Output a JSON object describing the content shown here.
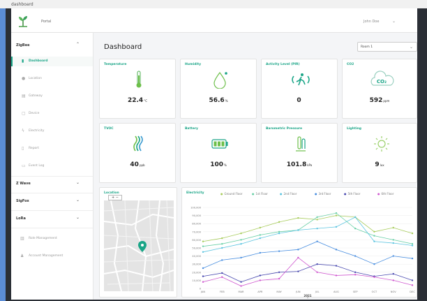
{
  "window": {
    "title": "dashboard"
  },
  "header": {
    "portal": "Portal",
    "user": "John Doe"
  },
  "sidebar": {
    "groups": [
      {
        "label": "ZigBee",
        "items": [
          {
            "label": "Dashboard",
            "icon": "bar-chart-icon",
            "active": true
          },
          {
            "label": "Location",
            "icon": "pin-icon"
          },
          {
            "label": "Gateway",
            "icon": "gateway-icon"
          },
          {
            "label": "Device",
            "icon": "device-icon"
          },
          {
            "label": "Electricity",
            "icon": "bolt-icon"
          },
          {
            "label": "Report",
            "icon": "report-icon"
          },
          {
            "label": "Event Log",
            "icon": "calendar-icon"
          }
        ]
      },
      {
        "label": "Z Wave"
      },
      {
        "label": "SigFox"
      },
      {
        "label": "LoRa"
      }
    ],
    "footer_items": [
      {
        "label": "Role Management",
        "icon": "building-icon"
      },
      {
        "label": "Account Management",
        "icon": "person-icon"
      }
    ]
  },
  "main": {
    "title": "Dashboard",
    "room_select": {
      "value": "Room 1"
    },
    "cards": [
      {
        "title": "Temperature",
        "value": "22.4",
        "unit": "°C",
        "icon": "thermometer-icon"
      },
      {
        "title": "Humidity",
        "value": "56.6",
        "unit": "%",
        "icon": "droplet-icon"
      },
      {
        "title": "Activity Level (PIR)",
        "value": "0",
        "unit": "",
        "icon": "motion-icon"
      },
      {
        "title": "CO2",
        "value": "592",
        "unit": "ppm",
        "icon": "co2-cloud-icon",
        "icon_text": "CO₂"
      },
      {
        "title": "TVOC",
        "value": "40",
        "unit": "ppb",
        "icon": "tvoc-waves-icon"
      },
      {
        "title": "Battery",
        "value": "100",
        "unit": "%",
        "icon": "battery-icon"
      },
      {
        "title": "Barometric Pressure",
        "value": "101.8",
        "unit": "kPa",
        "icon": "barometer-icon"
      },
      {
        "title": "Lighting",
        "value": "9",
        "unit": "lux",
        "icon": "sun-icon"
      }
    ],
    "location": {
      "title": "Location",
      "zoom_label": "+ −"
    },
    "electricity": {
      "title": "Electricity"
    }
  },
  "colors": {
    "accent": "#1aa587"
  },
  "chart_data": {
    "type": "line",
    "title": "Electricity",
    "categories": [
      "JAN",
      "FEB",
      "MAR",
      "APR",
      "MAY",
      "JUN",
      "JUL",
      "AUG",
      "SEP",
      "OCT",
      "NOV",
      "DEC"
    ],
    "xlabel": "2021\nS",
    "ylim": [
      0,
      100000
    ],
    "yticks": [
      0,
      10000,
      20000,
      30000,
      40000,
      50000,
      60000,
      70000,
      80000,
      90000,
      100000
    ],
    "ytick_labels": [
      "0",
      "10,000",
      "20,000",
      "30,000",
      "40,000",
      "50,000",
      "60,000",
      "70,000",
      "80,000",
      "90,000",
      "100,000"
    ],
    "legend_position": "top",
    "series": [
      {
        "name": "Ground Floor",
        "color": "#a8cc5c",
        "values": [
          58000,
          62000,
          68000,
          75000,
          82000,
          87000,
          85000,
          90000,
          88000,
          70000,
          75000,
          68000
        ]
      },
      {
        "name": "1st Floor",
        "color": "#6bd0a8",
        "values": [
          52000,
          55000,
          60000,
          66000,
          70000,
          72000,
          88000,
          93000,
          74000,
          65000,
          60000,
          55000
        ]
      },
      {
        "name": "2nd Floor",
        "color": "#5cc4e0",
        "values": [
          45000,
          50000,
          55000,
          62000,
          68000,
          72000,
          74000,
          76000,
          88000,
          58000,
          56000,
          53000
        ]
      },
      {
        "name": "3rd Floor",
        "color": "#4a8fe0",
        "values": [
          25000,
          35000,
          38000,
          44000,
          46000,
          48000,
          58000,
          48000,
          40000,
          30000,
          40000,
          37000
        ]
      },
      {
        "name": "5th Floor",
        "color": "#4a4ab0",
        "values": [
          15000,
          19000,
          8000,
          16000,
          20000,
          21000,
          30000,
          28000,
          20000,
          15000,
          18000,
          10000
        ]
      },
      {
        "name": "6th Floor",
        "color": "#d05ad0",
        "values": [
          8000,
          14000,
          3000,
          10000,
          12000,
          38000,
          20000,
          16000,
          17000,
          14000,
          10000,
          4000
        ]
      }
    ]
  }
}
